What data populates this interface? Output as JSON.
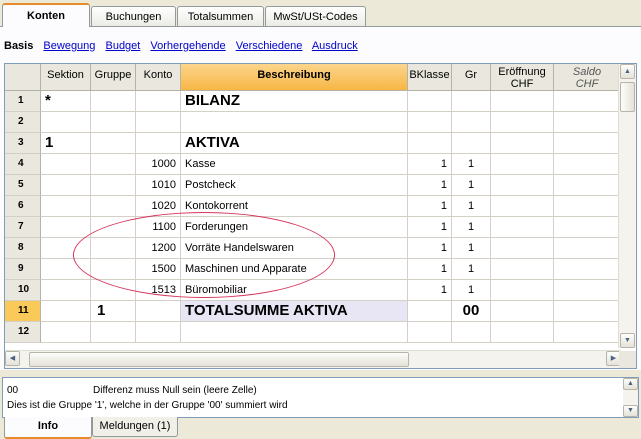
{
  "tabs": [
    "Konten",
    "Buchungen",
    "Totalsummen",
    "MwSt/USt-Codes"
  ],
  "subnav": {
    "active": "Basis",
    "links": [
      "Bewegung",
      "Budget",
      "Vorhergehende",
      "Verschiedene",
      "Ausdruck"
    ]
  },
  "columns": {
    "sektion": "Sektion",
    "gruppe": "Gruppe",
    "konto": "Konto",
    "beschreibung": "Beschreibung",
    "bklasse": "BKlasse",
    "gr": "Gr",
    "eroeffnung_1": "Eröffnung",
    "eroeffnung_2": "CHF",
    "saldo_1": "Saldo",
    "saldo_2": "CHF"
  },
  "rows": [
    {
      "n": "1",
      "sektion": "*",
      "gruppe": "",
      "konto": "",
      "beschreibung": "BILANZ",
      "bklasse": "",
      "gr": ""
    },
    {
      "n": "2",
      "sektion": "",
      "gruppe": "",
      "konto": "",
      "beschreibung": "",
      "bklasse": "",
      "gr": ""
    },
    {
      "n": "3",
      "sektion": "1",
      "gruppe": "",
      "konto": "",
      "beschreibung": "AKTIVA",
      "bklasse": "",
      "gr": ""
    },
    {
      "n": "4",
      "sektion": "",
      "gruppe": "",
      "konto": "1000",
      "beschreibung": "Kasse",
      "bklasse": "1",
      "gr": "1"
    },
    {
      "n": "5",
      "sektion": "",
      "gruppe": "",
      "konto": "1010",
      "beschreibung": "Postcheck",
      "bklasse": "1",
      "gr": "1"
    },
    {
      "n": "6",
      "sektion": "",
      "gruppe": "",
      "konto": "1020",
      "beschreibung": "Kontokorrent",
      "bklasse": "1",
      "gr": "1"
    },
    {
      "n": "7",
      "sektion": "",
      "gruppe": "",
      "konto": "1100",
      "beschreibung": "Forderungen",
      "bklasse": "1",
      "gr": "1"
    },
    {
      "n": "8",
      "sektion": "",
      "gruppe": "",
      "konto": "1200",
      "beschreibung": "Vorräte Handelswaren",
      "bklasse": "1",
      "gr": "1"
    },
    {
      "n": "9",
      "sektion": "",
      "gruppe": "",
      "konto": "1500",
      "beschreibung": "Maschinen und Apparate",
      "bklasse": "1",
      "gr": "1"
    },
    {
      "n": "10",
      "sektion": "",
      "gruppe": "",
      "konto": "1513",
      "beschreibung": "Büromobiliar",
      "bklasse": "1",
      "gr": "1"
    },
    {
      "n": "11",
      "sektion": "",
      "gruppe": "1",
      "konto": "",
      "beschreibung": "TOTALSUMME AKTIVA",
      "bklasse": "",
      "gr": "00"
    },
    {
      "n": "12",
      "sektion": "",
      "gruppe": "",
      "konto": "",
      "beschreibung": "",
      "bklasse": "",
      "gr": ""
    }
  ],
  "info": {
    "code": "00",
    "message": "Differenz muss Null sein (leere Zelle)",
    "line2": "Dies ist die Gruppe '1', welche in der Gruppe '00' summiert wird"
  },
  "bottom_tabs": [
    "Info",
    "Meldungen (1)"
  ]
}
